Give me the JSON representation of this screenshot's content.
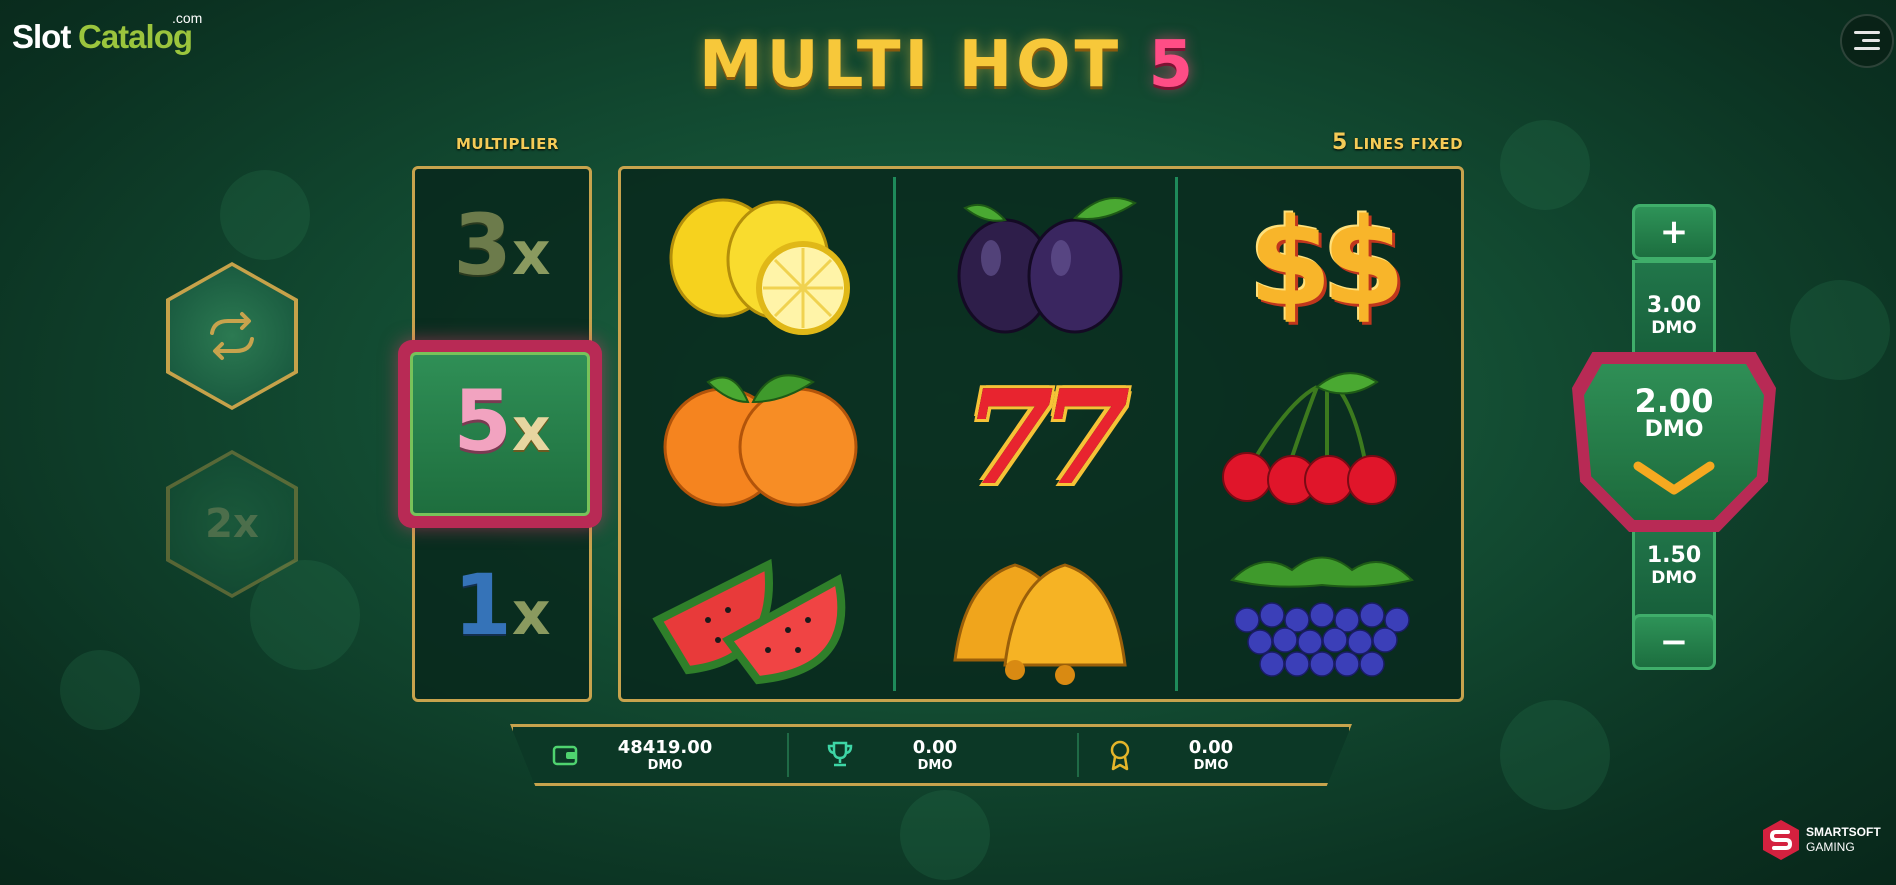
{
  "logo": {
    "word1": "Slot",
    "word2": "Catalog",
    "domain": ".com"
  },
  "title": {
    "main": "MULTI HOT",
    "number": "5"
  },
  "labels": {
    "multiplier": "MULTIPLIER",
    "lines_number": "5",
    "lines_text": "LINES FIXED"
  },
  "multipliers": [
    {
      "num": "3",
      "x": "x",
      "num_color": "#6c7b4b",
      "active": false
    },
    {
      "num": "5",
      "x": "x",
      "num_color": "#f2a3c0",
      "active": true
    },
    {
      "num": "1",
      "x": "x",
      "num_color": "#3573b8",
      "active": false
    }
  ],
  "side_buttons": {
    "autoplay_icon": "refresh-icon",
    "double_label": "2x"
  },
  "reels": [
    [
      "lemons",
      "oranges",
      "watermelons"
    ],
    [
      "plums",
      "sevens",
      "bells"
    ],
    [
      "dollars",
      "cherries",
      "grapes"
    ]
  ],
  "symbols": {
    "sevens": "77",
    "dollars": "$$"
  },
  "bet": {
    "plus_label": "+",
    "minus_label": "−",
    "higher": {
      "value": "3.00",
      "currency": "DMO"
    },
    "current": {
      "value": "2.00",
      "currency": "DMO"
    },
    "lower": {
      "value": "1.50",
      "currency": "DMO"
    }
  },
  "bottom_bar": {
    "balance": {
      "icon": "wallet-icon",
      "value": "48419.00",
      "currency": "DMO"
    },
    "win": {
      "icon": "trophy-icon",
      "value": "0.00",
      "currency": "DMO"
    },
    "bonus": {
      "icon": "medal-icon",
      "value": "0.00",
      "currency": "DMO"
    }
  },
  "brand": {
    "line1": "SMARTSOFT",
    "line2": "GAMING"
  },
  "colors": {
    "gold": "#c7a34d",
    "pink": "#b82a55",
    "green": "#1f6a46"
  }
}
